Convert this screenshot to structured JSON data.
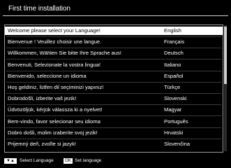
{
  "header": {
    "title": "First time installation"
  },
  "languages": [
    {
      "greeting": "Welcome please select your Language!",
      "language": "English",
      "selected": true
    },
    {
      "greeting": "Bienvenue ! Veuillez choisir une langue.",
      "language": "Français"
    },
    {
      "greeting": "Willkommen, Wählen Sie bitte Ihre Sprache aus!",
      "language": "Deutsch"
    },
    {
      "greeting": "Benvenuti, Selezionate la vostra lingua!",
      "language": "Italiano"
    },
    {
      "greeting": "Bienvenido, seleccione un idioma",
      "language": "Español"
    },
    {
      "greeting": "Hoş geldiniz, lütfen dil seçiminizi yapınız!",
      "language": "Türkçe"
    },
    {
      "greeting": "Dobrodošli, izberite vaš jezik!",
      "language": "Slovenski"
    },
    {
      "greeting": "Üdvözöljük, kérjük válassza ki a nyelvet!",
      "language": "Magyar"
    },
    {
      "greeting": "Bem-vindo, favor selecionar seu idioma",
      "language": "Português"
    },
    {
      "greeting": "Dobro došli, molim izaberite svoj jezik!",
      "language": "Hrvatski"
    },
    {
      "greeting": "Prijemný deň, zvoľte si jazyk!",
      "language": "Slovenčina"
    }
  ],
  "footer": {
    "nav_key": "▼▲",
    "nav_hint": "Select Language",
    "ok_key": "OK",
    "ok_hint": "Set language"
  },
  "colors": {
    "background": "#000000",
    "selected_row": "#ffffff",
    "text": "#ffffff"
  }
}
